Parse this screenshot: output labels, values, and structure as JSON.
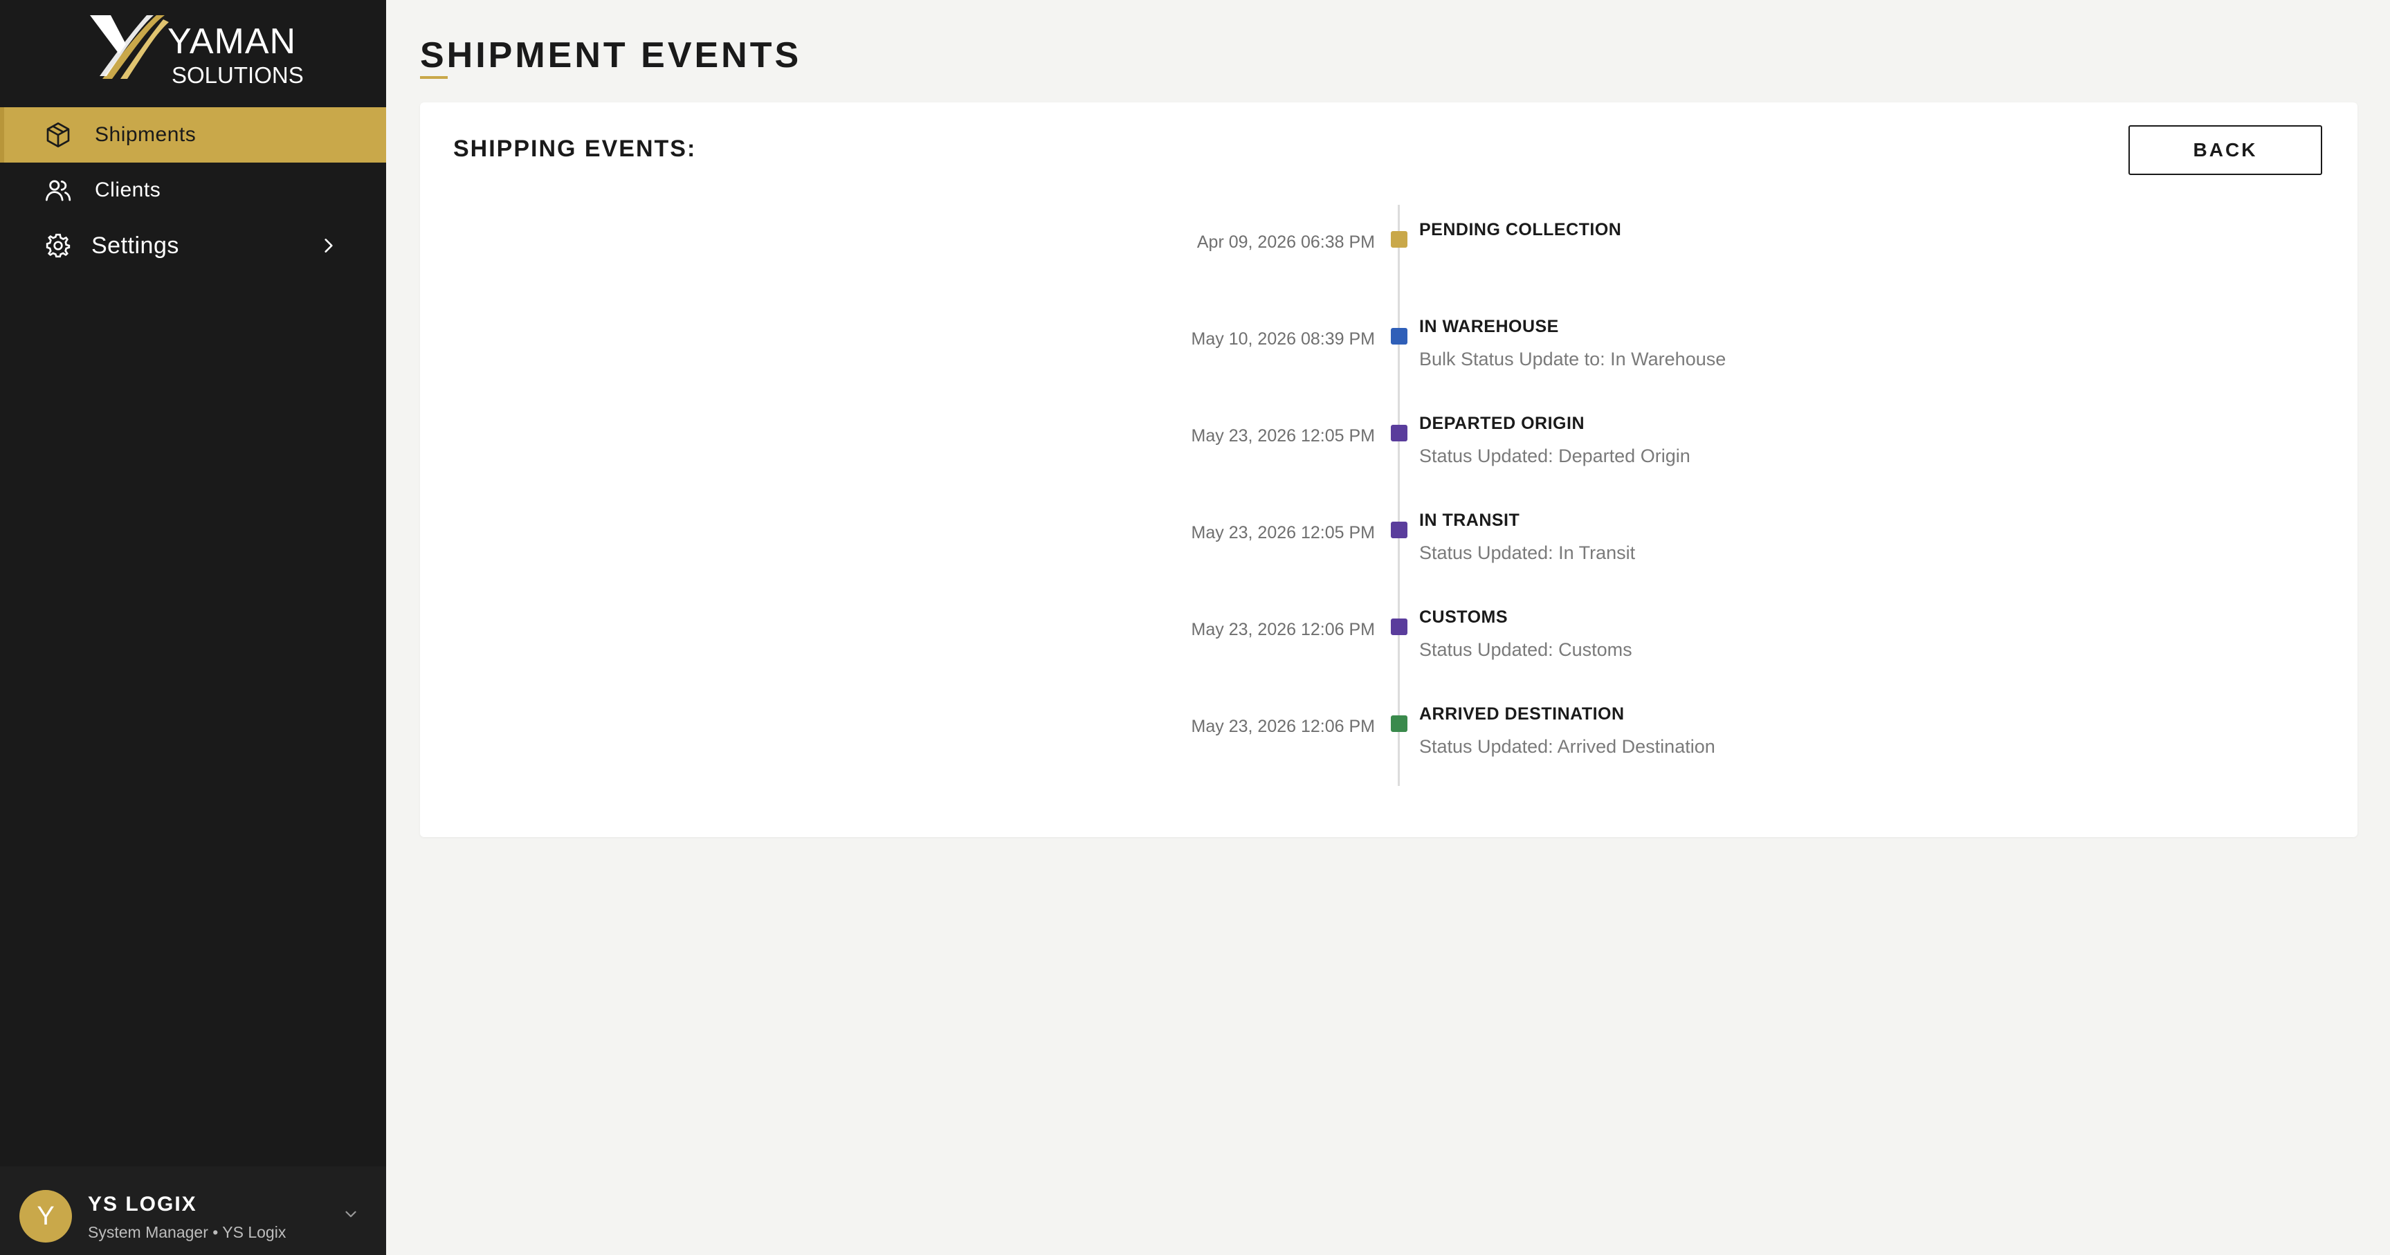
{
  "brand": {
    "name_line1": "YAMAN",
    "name_line2": "SOLUTIONS",
    "accent_color": "#c9a84a"
  },
  "sidebar": {
    "items": [
      {
        "label": "Shipments",
        "icon": "package-icon",
        "active": true
      },
      {
        "label": "Clients",
        "icon": "users-icon",
        "active": false
      },
      {
        "label": "Settings",
        "icon": "gear-icon",
        "active": false,
        "has_submenu": true
      }
    ],
    "user": {
      "initial": "Y",
      "name": "YS LOGIX",
      "role": "System Manager • YS Logix"
    }
  },
  "page": {
    "title": "SHIPMENT EVENTS"
  },
  "card": {
    "title": "SHIPPING EVENTS:",
    "back_label": "BACK"
  },
  "events": [
    {
      "date": "Apr 09, 2026 06:38 PM",
      "status": "PENDING COLLECTION",
      "description": "",
      "color": "#c9a84a"
    },
    {
      "date": "May 10, 2026 08:39 PM",
      "status": "IN WAREHOUSE",
      "description": "Bulk Status Update to: In Warehouse",
      "color": "#2f5fb8"
    },
    {
      "date": "May 23, 2026 12:05 PM",
      "status": "DEPARTED ORIGIN",
      "description": "Status Updated: Departed Origin",
      "color": "#5a3d9c"
    },
    {
      "date": "May 23, 2026 12:05 PM",
      "status": "IN TRANSIT",
      "description": "Status Updated: In Transit",
      "color": "#5a3d9c"
    },
    {
      "date": "May 23, 2026 12:06 PM",
      "status": "CUSTOMS",
      "description": "Status Updated: Customs",
      "color": "#5a3d9c"
    },
    {
      "date": "May 23, 2026 12:06 PM",
      "status": "ARRIVED DESTINATION",
      "description": "Status Updated: Arrived Destination",
      "color": "#3a8a4c"
    }
  ]
}
